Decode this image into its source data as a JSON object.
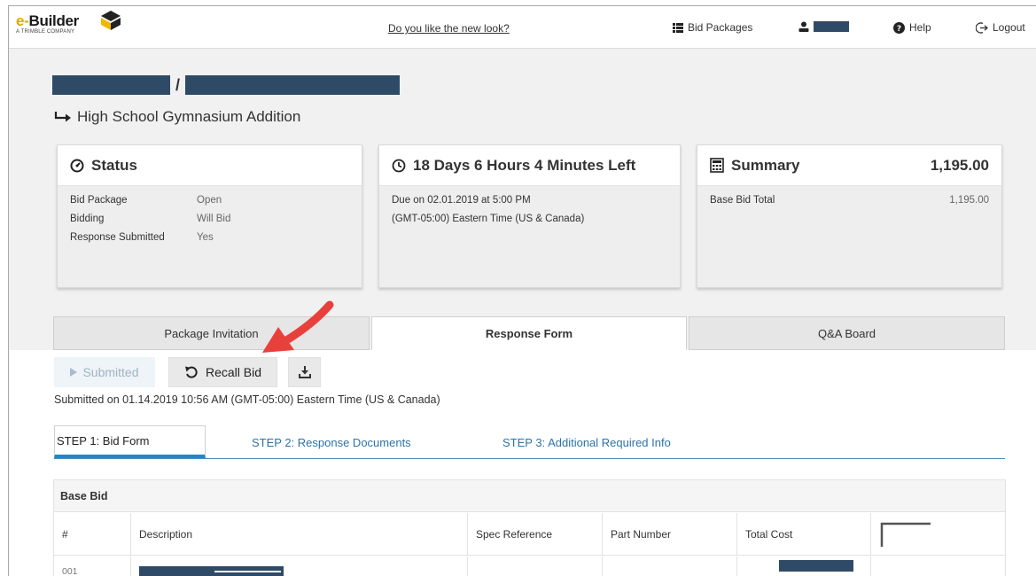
{
  "nav": {
    "logo_text": "Builder",
    "logo_e": "e-",
    "logo_sub": "A TRIMBLE COMPANY",
    "feedback_link": "Do you like the new look?",
    "bid_packages": "Bid Packages",
    "help": "Help",
    "logout": "Logout"
  },
  "header": {
    "crumb_sep": "/",
    "project_name": "High School Gymnasium Addition"
  },
  "status_card": {
    "title": "Status",
    "rows": [
      {
        "label": "Bid Package",
        "value": "Open"
      },
      {
        "label": "Bidding",
        "value": "Will Bid"
      },
      {
        "label": "Response Submitted",
        "value": "Yes"
      }
    ]
  },
  "time_card": {
    "title": "18 Days 6 Hours 4 Minutes Left",
    "due": "Due on 02.01.2019 at 5:00 PM",
    "timezone": "(GMT-05:00) Eastern Time (US & Canada)"
  },
  "summary_card": {
    "title": "Summary",
    "total": "1,195.00",
    "row_label": "Base Bid Total",
    "row_value": "1,195.00"
  },
  "tabs": [
    {
      "label": "Package Invitation"
    },
    {
      "label": "Response Form"
    },
    {
      "label": "Q&A Board"
    }
  ],
  "actions": {
    "submitted": "Submitted",
    "recall": "Recall Bid",
    "submitted_on": "Submitted on 01.14.2019 10:56 AM (GMT-05:00) Eastern Time (US & Canada)"
  },
  "steps": [
    {
      "label": "STEP 1: Bid Form"
    },
    {
      "label": "STEP 2: Response Documents"
    },
    {
      "label": "STEP 3: Additional Required Info"
    }
  ],
  "table": {
    "title": "Base Bid",
    "headers": [
      "#",
      "Description",
      "Spec Reference",
      "Part Number",
      "Total Cost"
    ],
    "row": {
      "num": "001"
    }
  },
  "colors": {
    "accent_blue": "#1f86c9",
    "link_blue": "#2c73a8",
    "redaction": "#2f4a66",
    "arrow_red": "#e8403b"
  }
}
